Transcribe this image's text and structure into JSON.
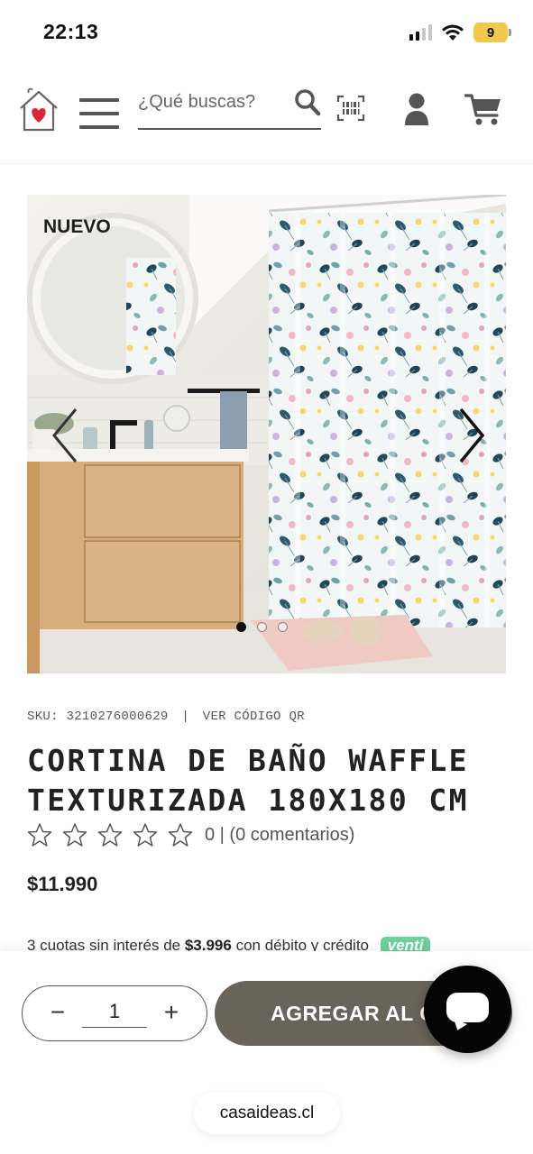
{
  "status_bar": {
    "time": "22:13",
    "battery": "9",
    "wifi_icon": "wifi-icon",
    "signal_icon": "cellular-signal-icon"
  },
  "header": {
    "logo_icon": "house-heart-logo",
    "menu_icon": "hamburger-menu-icon",
    "search_placeholder": "¿Qué buscas?",
    "search_icon": "search-icon",
    "barcode_icon": "barcode-scanner-icon",
    "user_icon": "user-account-icon",
    "cart_icon": "shopping-cart-icon"
  },
  "gallery": {
    "badge": "NUEVO",
    "slide_count": 3,
    "active_slide": 1,
    "image_alt": "shower-curtain-floral-bathroom-photo"
  },
  "product": {
    "sku_label": "SKU:",
    "sku": "3210276000629",
    "separator": "|",
    "qr_link": "VER CÓDIGO QR",
    "title": "CORTINA DE BAÑO WAFFLE TEXTURIZADA 180X180 CM",
    "rating_stars": 0,
    "rating_max": 5,
    "rating_text": "0 | (0 comentarios)",
    "price": "$11.990",
    "installments_prefix": "3 cuotas sin interés de",
    "installments_amount": "$3.996",
    "installments_suffix": "con débito y crédito",
    "installments_badge": "venti"
  },
  "cart_bar": {
    "qty_minus": "−",
    "qty_value": "1",
    "qty_plus": "+",
    "add_to_cart_label": "AGREGAR AL CARRO",
    "chat_icon": "chat-bubble-icon"
  },
  "browser": {
    "url": "casaideas.cl"
  },
  "colors": {
    "primary_button": "#6a635a",
    "venti_green": "#6fd09a",
    "heart_red": "#d9253a",
    "chat_button": "#050505"
  }
}
